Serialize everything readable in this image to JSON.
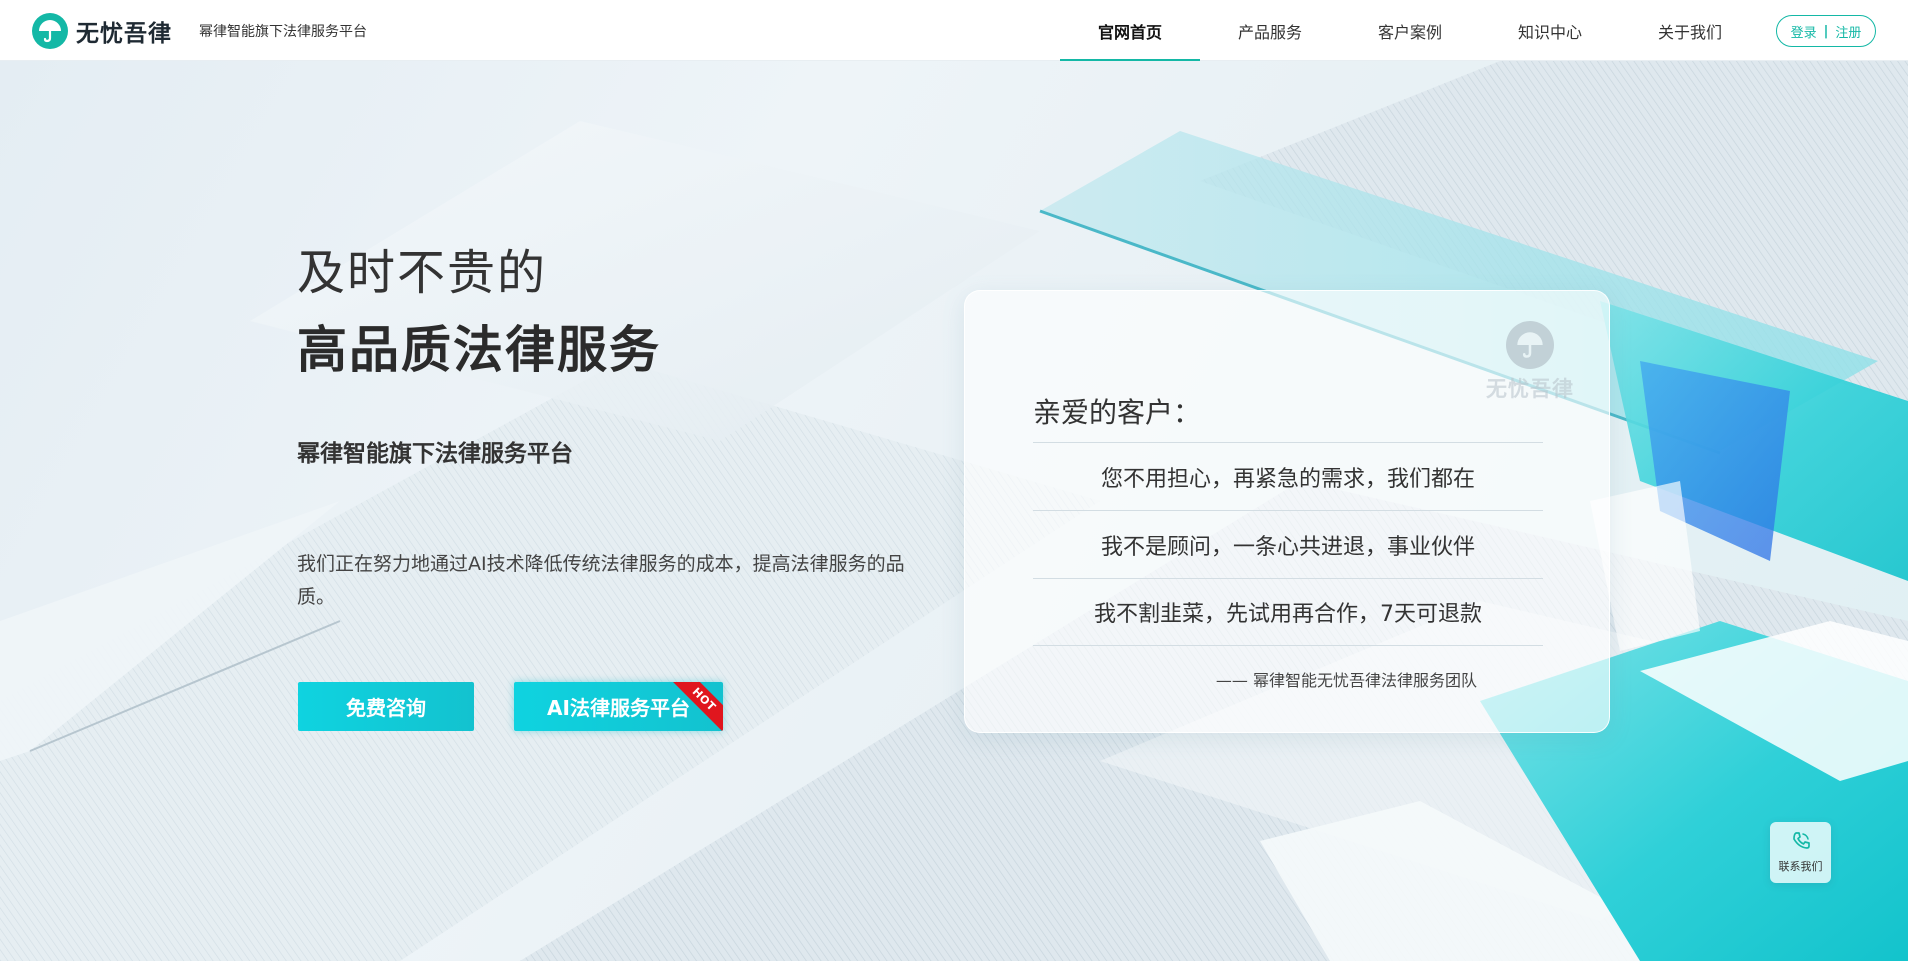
{
  "header": {
    "logo_text": "无忧吾律",
    "slogan": "幂律智能旗下法律服务平台",
    "nav": [
      {
        "label": "官网首页",
        "active": true
      },
      {
        "label": "产品服务",
        "active": false
      },
      {
        "label": "客户案例",
        "active": false
      },
      {
        "label": "知识中心",
        "active": false
      },
      {
        "label": "关于我们",
        "active": false
      }
    ],
    "login_label": "登录",
    "register_label": "注册"
  },
  "hero": {
    "title_line1": "及时不贵的",
    "title_line2": "高品质法律服务",
    "subtitle": "幂律智能旗下法律服务平台",
    "description": "我们正在努力地通过AI技术降低传统法律服务的成本，提高法律服务的品质。",
    "btn_consult": "免费咨询",
    "btn_ai": "AI法律服务平台",
    "hot_badge": "HOT"
  },
  "card": {
    "watermark_text": "无忧吾律",
    "greeting": "亲爱的客户：",
    "lines": [
      "您不用担心，再紧急的需求，我们都在",
      "我不是顾问，一条心共进退，事业伙伴",
      "我不割韭菜，先试用再合作，7天可退款"
    ],
    "signature": "—— 幂律智能无忧吾律法律服务团队"
  },
  "contact": {
    "label": "联系我们",
    "icon": "phone-icon"
  },
  "colors": {
    "brand": "#14b8a6",
    "button": "#13c2cf",
    "hot": "#e0161e"
  }
}
